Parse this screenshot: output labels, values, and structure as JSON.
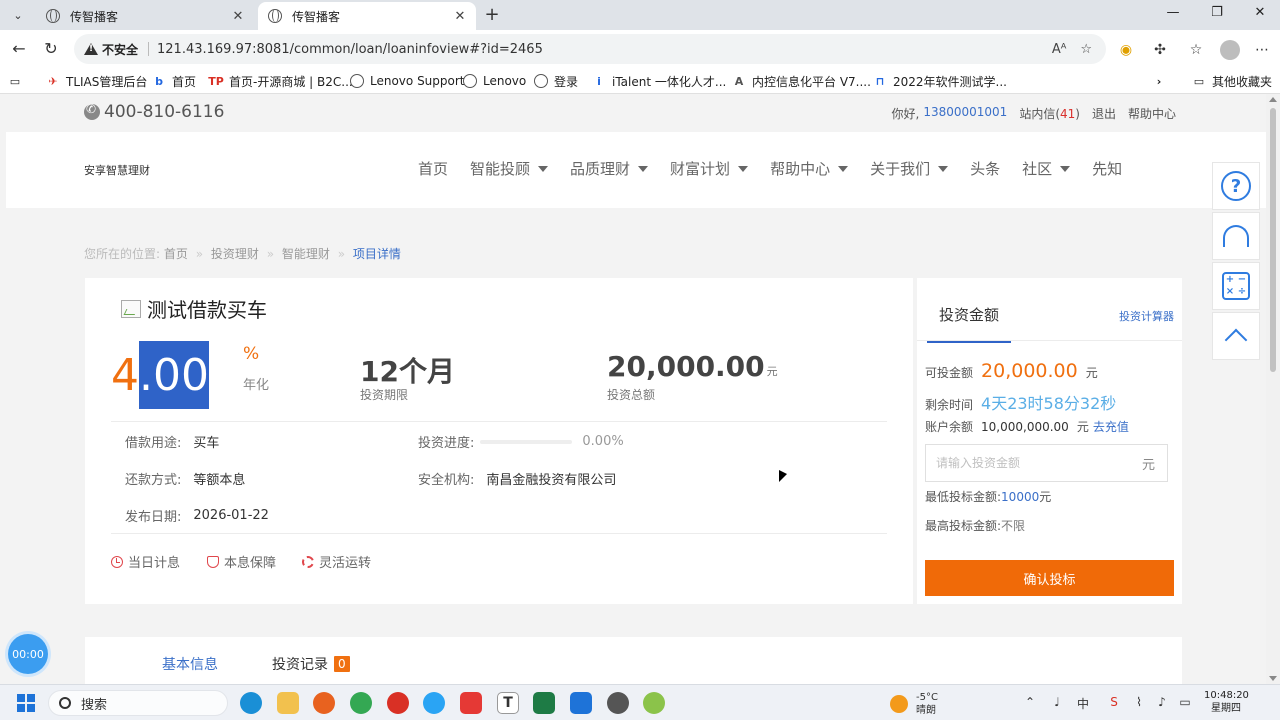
{
  "browser": {
    "tabs": [
      {
        "title": "传智播客"
      },
      {
        "title": "传智播客"
      }
    ],
    "insecure_label": "不安全",
    "url": "121.43.169.97:8081/common/loan/loaninfoview#?id=2465",
    "bookmarks": [
      "TLIAS管理后台",
      "首页",
      "首页-开源商城 | B2C...",
      "Lenovo Support",
      "Lenovo",
      "登录",
      "iTalent 一体化人才...",
      "内控信息化平台 V7....",
      "2022年软件测试学..."
    ],
    "other_bookmarks": "其他收藏夹"
  },
  "site": {
    "phone": "400-810-6116",
    "greeting": "你好,",
    "username": "13800001001",
    "inbox_label": "站内信(",
    "inbox_count": "41",
    "inbox_close": ")",
    "logout": "退出",
    "help_center": "帮助中心",
    "logo_text": "安享智慧理财",
    "menu": [
      {
        "label": "首页",
        "dropdown": false
      },
      {
        "label": "智能投顾",
        "dropdown": true
      },
      {
        "label": "品质理财",
        "dropdown": true
      },
      {
        "label": "财富计划",
        "dropdown": true
      },
      {
        "label": "帮助中心",
        "dropdown": true
      },
      {
        "label": "关于我们",
        "dropdown": true
      },
      {
        "label": "头条",
        "dropdown": false
      },
      {
        "label": "社区",
        "dropdown": true
      },
      {
        "label": "先知",
        "dropdown": false
      }
    ],
    "breadcrumb": {
      "prefix": "您所在的位置:",
      "items": [
        "首页",
        "投资理财",
        "智能理财"
      ],
      "current": "项目详情",
      "separator": "»"
    }
  },
  "project": {
    "title": "测试借款买车",
    "rate_int": "4",
    "rate_dec": ".00",
    "rate_unit": "%",
    "rate_label": "年化",
    "term": "12个月",
    "term_label": "投资期限",
    "total": "20,000.00",
    "total_unit": "元",
    "total_label": "投资总额",
    "purpose_label": "借款用途:",
    "purpose": "买车",
    "progress_label": "投资进度:",
    "progress_value": 0,
    "progress_text": "0.00%",
    "repay_label": "还款方式:",
    "repay": "等额本息",
    "org_label": "安全机构:",
    "org": "南昌金融投资有限公司",
    "date_label": "发布日期:",
    "date": "2026-01-22",
    "features": [
      "当日计息",
      "本息保障",
      "灵活运转"
    ]
  },
  "invest": {
    "tab": "投资金额",
    "calculator": "投资计算器",
    "available_label": "可投金额",
    "available": "20,000.00",
    "available_unit": "元",
    "remaining_label": "剩余时间",
    "remaining": "4天23时58分32秒",
    "balance_label": "账户余额",
    "balance": "10,000,000.00",
    "balance_unit": "元",
    "recharge": "去充值",
    "input_placeholder": "请输入投资金额",
    "input_unit": "元",
    "min_label": "最低投标金额:",
    "min_value": "10000",
    "min_unit": "元",
    "max_label": "最高投标金额:",
    "max_value": "不限",
    "confirm": "确认投标"
  },
  "bottom_tabs": {
    "basic": "基本信息",
    "records": "投资记录",
    "records_count": "0"
  },
  "timer": "00:00",
  "taskbar": {
    "search": "搜索",
    "temperature": "-5°C",
    "weather": "晴朗",
    "time": "10:48:20",
    "weekday": "星期四",
    "ime": "中"
  },
  "colors": {
    "accent_orange": "#f07010",
    "link_blue": "#3a6fc8",
    "button_orange": "#f06a08"
  }
}
